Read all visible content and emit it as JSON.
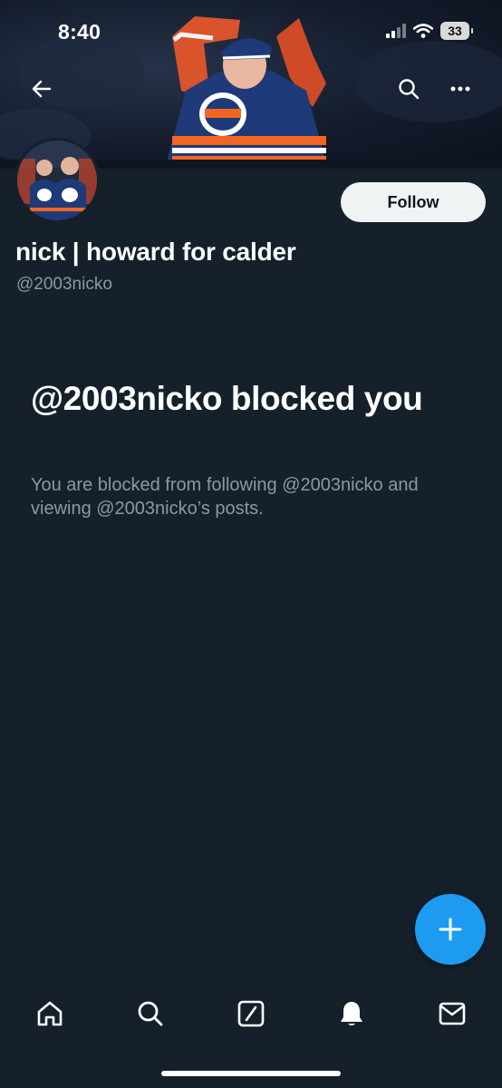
{
  "status_bar": {
    "time": "8:40",
    "battery": "33",
    "icons": [
      "signal-icon",
      "wifi-icon",
      "battery-icon"
    ]
  },
  "header": {
    "back_icon": "back-arrow-icon",
    "search_icon": "search-icon",
    "more_icon": "more-icon"
  },
  "profile": {
    "display_name": "nick | howard for calder",
    "handle": "@2003nicko",
    "follow_label": "Follow"
  },
  "blocked": {
    "title": "@2003nicko blocked you",
    "description": "You are blocked from following @2003nicko and viewing @2003nicko’s posts."
  },
  "fab": {
    "icon": "plus-icon"
  },
  "tab_bar": {
    "items": [
      "home-icon",
      "search-icon",
      "grok-icon",
      "notifications-icon",
      "messages-icon"
    ]
  },
  "colors": {
    "background": "#15202b",
    "accent": "#1d9bf0",
    "secondary_text": "#8b98a5",
    "follow_button_bg": "#eff3f4"
  }
}
